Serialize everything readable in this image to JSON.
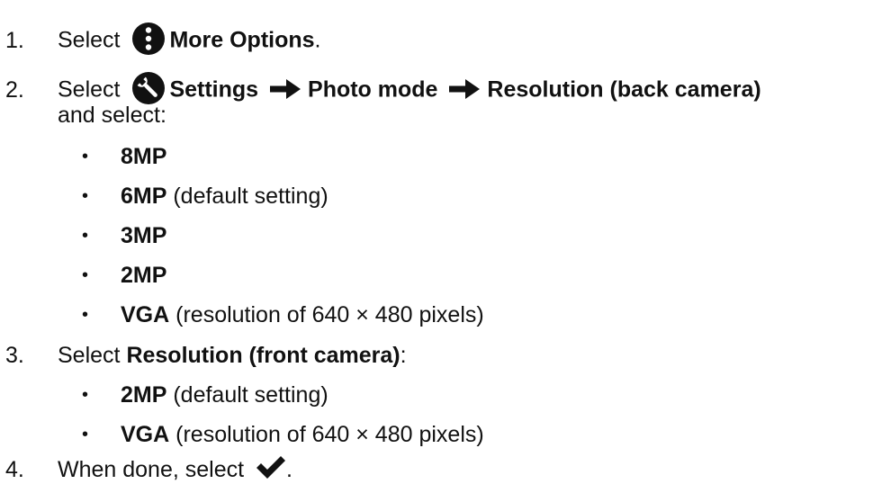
{
  "steps": [
    {
      "number": "1.",
      "select_text": "Select",
      "icon": "more-options-icon",
      "bold": "More Options",
      "trail": "."
    },
    {
      "number": "2.",
      "select_text": "Select",
      "icon": "wrench-settings-icon",
      "path": [
        "Settings",
        "Photo mode",
        "Resolution (back camera)"
      ],
      "continuation": "and select:",
      "options": [
        {
          "bold": "8MP",
          "rest": ""
        },
        {
          "bold": "6MP",
          "rest": " (default setting)"
        },
        {
          "bold": "3MP",
          "rest": ""
        },
        {
          "bold": "2MP",
          "rest": ""
        },
        {
          "bold": "VGA",
          "rest": " (resolution of 640 × 480 pixels)"
        }
      ]
    },
    {
      "number": "3.",
      "select_text": "Select ",
      "bold": "Resolution (front camera)",
      "trail": ":",
      "options": [
        {
          "bold": "2MP",
          "rest": " (default setting)"
        },
        {
          "bold": "VGA",
          "rest": " (resolution of 640 × 480 pixels)"
        }
      ]
    },
    {
      "number": "4.",
      "text": "When done, select",
      "icon": "checkmark-icon",
      "trail": "."
    }
  ],
  "bullet_char": "•",
  "arrow_icon": "right-arrow-icon"
}
